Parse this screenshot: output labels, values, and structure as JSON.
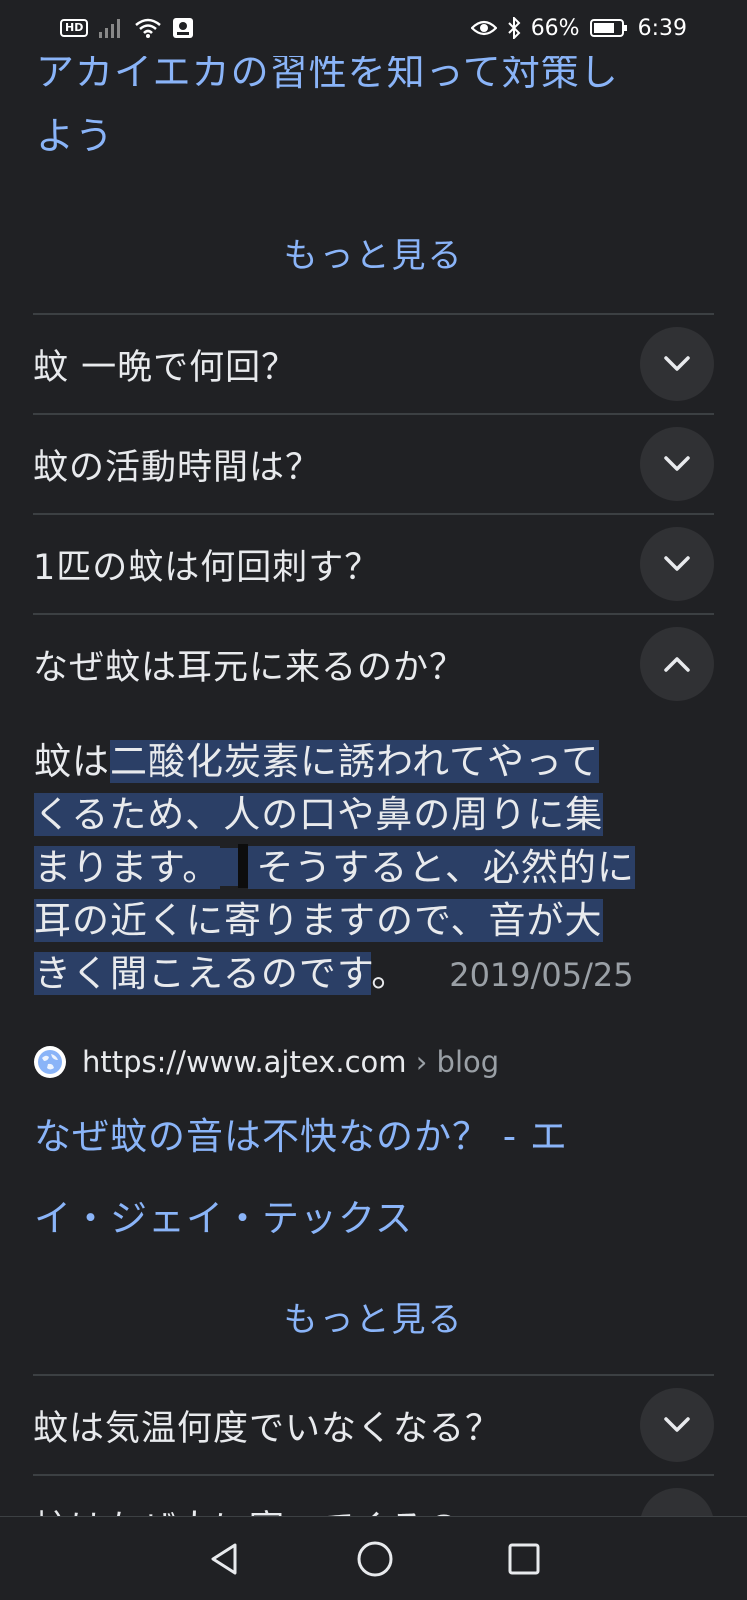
{
  "status_bar": {
    "hd": "HD",
    "battery": "66%",
    "time": "6:39"
  },
  "previous_result": {
    "title_line1": "アカイエカの習性を知って対策し",
    "title_line2": "よう"
  },
  "more_label_1": "もっと見る",
  "questions": [
    {
      "text": "蚊 一晩で何回？",
      "icon": "chevron-down-icon"
    },
    {
      "text": "蚊の活動時間は？",
      "icon": "chevron-down-icon"
    },
    {
      "text": "1匹の蚊は何回刺す？",
      "icon": "chevron-down-icon"
    },
    {
      "text": "なぜ蚊は耳元に来るのか？",
      "icon": "chevron-up-icon"
    }
  ],
  "answer": {
    "pre": "蚊は",
    "highlight_1": "二酸化炭素に誘われてやって",
    "highlight_2": "くるため、人の口や鼻の周りに集",
    "highlight_3": "まります。",
    "highlight_4": "そうすると、必然的に",
    "highlight_5": "耳の近くに寄りますので、音が大",
    "highlight_6": "きく聞こえるのです",
    "post": "。",
    "date": "2019/05/25"
  },
  "source": {
    "url": "https://www.ajtex.com",
    "path": " › blog",
    "favicon": "globe-icon"
  },
  "result": {
    "title_line1": "なぜ蚊の音は不快なのか？ - エ",
    "title_line2": "イ・ジェイ・テックス"
  },
  "more_label_2": "もっと見る",
  "questions_2": [
    {
      "text": "蚊は気温何度でいなくなる？",
      "icon": "chevron-down-icon"
    },
    {
      "text": "蚊はなぜ人に寄ってくるの",
      "icon": "chevron-down-icon"
    }
  ],
  "colors": {
    "background": "#202124",
    "link": "#8ab4f8",
    "highlight": "#2b3f66",
    "divider": "#3c4043"
  }
}
